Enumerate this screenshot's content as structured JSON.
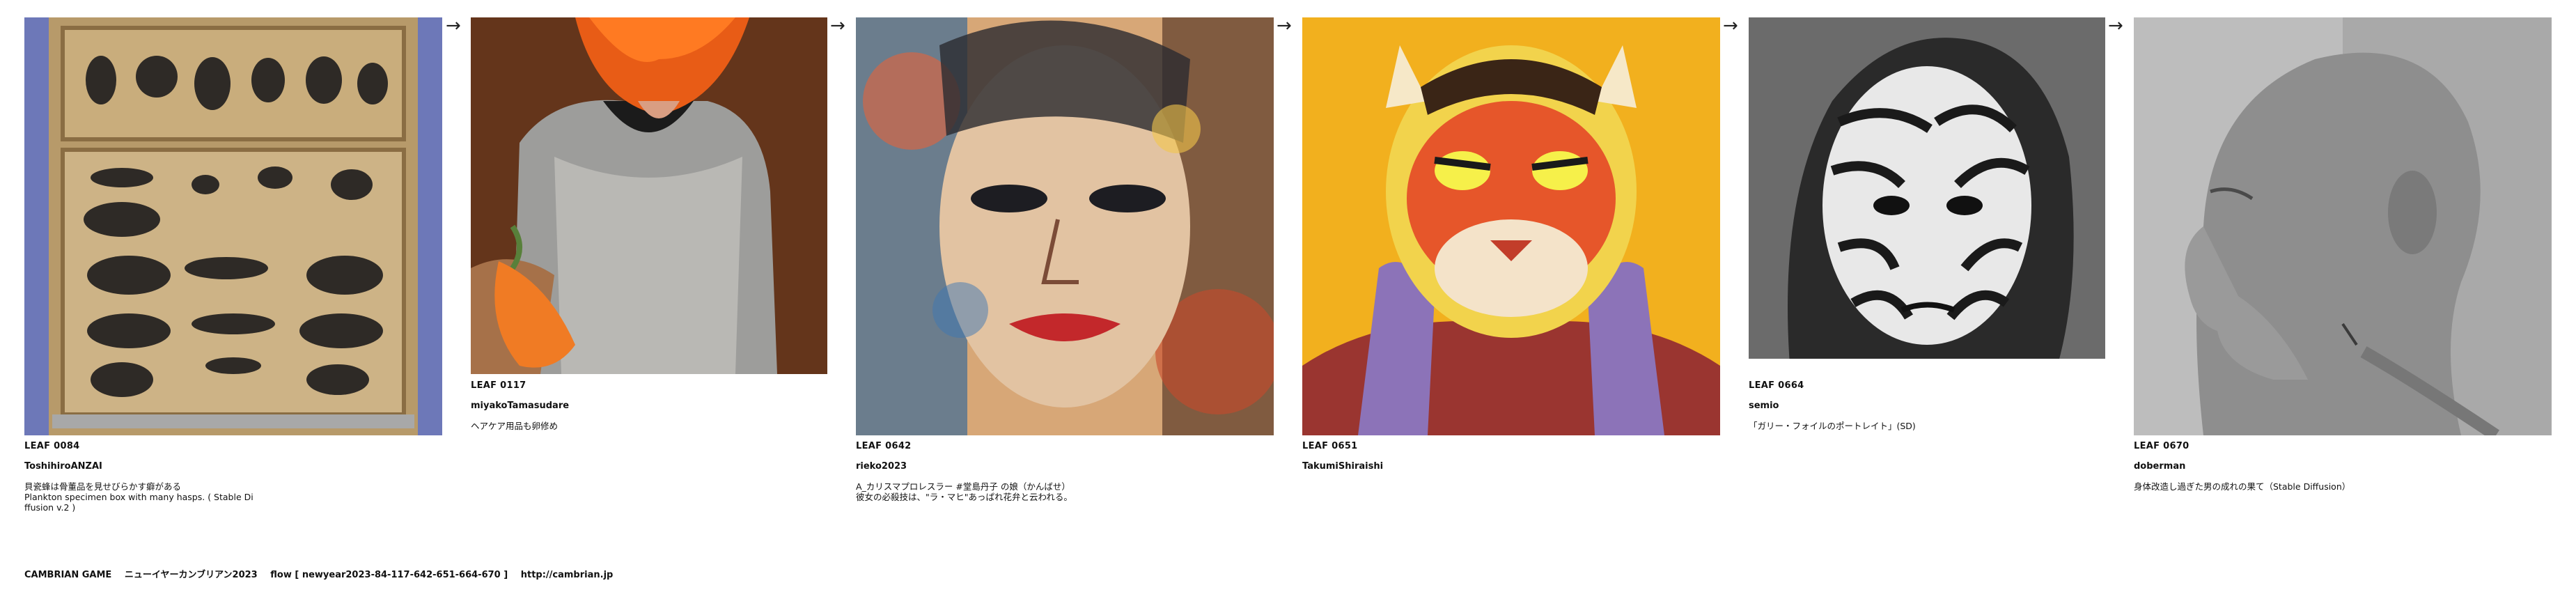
{
  "entries": [
    {
      "leaf": "LEAF 0084",
      "author": "ToshihiroANZAI",
      "description": "貝瓷蜂は骨董品を見せびらかす癖がある\nPlankton specimen box with many hasps. ( Stable Di\nffusion v.2 )",
      "image_icon": "specimen-box-image"
    },
    {
      "leaf": "LEAF 0117",
      "author": "miyakoTamasudare",
      "description": "ヘアケア用品も卵修め",
      "image_icon": "orange-hair-armor-image"
    },
    {
      "leaf": "LEAF 0642",
      "author": "rieko2023",
      "description": "A_カリスマプロレスラー #堂島丹子 の娘（かんばせ）\n彼女の必殺技は、\"ラ・マヒ\"あっぱれ花弁と云われる。",
      "image_icon": "painted-face-image"
    },
    {
      "leaf": "LEAF 0651",
      "author": "TakumiShiraishi",
      "description": "",
      "image_icon": "tiger-portrait-image"
    },
    {
      "leaf": "LEAF 0664",
      "author": "semio",
      "description": "「ガリー・フォイルのポートレイト」(SD)",
      "image_icon": "zebra-face-image"
    },
    {
      "leaf": "LEAF 0670",
      "author": "doberman",
      "description": "身体改造し過ぎた男の成れの果て（Stable Diffusion）",
      "image_icon": "bald-man-profile-image"
    }
  ],
  "arrow_glyph": "→",
  "footer": {
    "title": "CAMBRIAN GAME",
    "subtitle": "ニューイヤーカンブリアン2023",
    "flow": "flow [ newyear2023-84-117-642-651-664-670 ]",
    "url": "http://cambrian.jp"
  },
  "colors": {
    "background": "#ffffff",
    "text": "#111111"
  }
}
